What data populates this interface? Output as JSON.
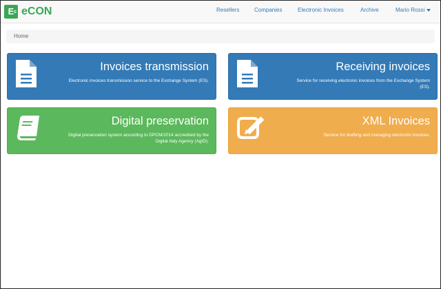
{
  "brand": {
    "logo_text": "E",
    "logo_sup": "c",
    "name": "eCON"
  },
  "nav": {
    "items": [
      "Resellers",
      "Companies",
      "Electronic Invoices",
      "Archive"
    ],
    "user": "Mario Rossi"
  },
  "breadcrumb": {
    "current": "Home"
  },
  "tiles": [
    {
      "title": "Invoices transmission",
      "desc": "Electronic invoices transmission service to the Exchange System (ES).",
      "color": "#337ab7",
      "icon": "file-text-icon"
    },
    {
      "title": "Receiving invoices",
      "desc": "Service for receiving electronic invoices from the Exchange System (ES).",
      "color": "#337ab7",
      "icon": "file-text-icon"
    },
    {
      "title": "Digital preservation",
      "desc": "Digital preservation system according to DPCM/2014 accredited by the Digital Italy Agency (AgID).",
      "color": "#5cb85c",
      "icon": "book-icon"
    },
    {
      "title": "XML Invoices",
      "desc": "Service for drafting and managing electronic invoices.",
      "color": "#f0ad4e",
      "icon": "edit-icon"
    }
  ]
}
